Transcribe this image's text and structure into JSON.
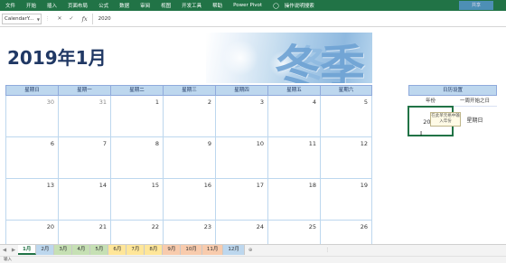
{
  "ribbon": {
    "tabs": [
      "文件",
      "开始",
      "插入",
      "页面布局",
      "公式",
      "数据",
      "审阅",
      "视图",
      "开发工具",
      "帮助",
      "Power Pivot"
    ],
    "tell_me": "操作说明搜索",
    "share_label": "共享"
  },
  "formula_bar": {
    "name_box": "CalendarY...",
    "formula_value": "2020"
  },
  "calendar": {
    "title": "2019年1月",
    "banner_text": "冬季",
    "weekdays": [
      "星期日",
      "星期一",
      "星期二",
      "星期三",
      "星期四",
      "星期五",
      "星期六"
    ],
    "weeks": [
      [
        "30",
        "31",
        "1",
        "2",
        "3",
        "4",
        "5"
      ],
      [
        "6",
        "7",
        "8",
        "9",
        "10",
        "11",
        "12"
      ],
      [
        "13",
        "14",
        "15",
        "16",
        "17",
        "18",
        "19"
      ],
      [
        "20",
        "21",
        "22",
        "23",
        "24",
        "25",
        "26"
      ]
    ]
  },
  "settings": {
    "title": "日历设置",
    "year_label": "年份",
    "week_start_label": "一周开始之日",
    "year_value": "2020",
    "week_start_value": "星期日",
    "tooltip": "在此单元格中输入年份"
  },
  "sheet_tabs": [
    "1月",
    "2月",
    "3月",
    "4月",
    "5月",
    "6月",
    "7月",
    "8月",
    "9月",
    "10月",
    "11月",
    "12月"
  ],
  "sheet_tab_colors": [
    "#ffffff",
    "#bdd7ee",
    "#c6e0b4",
    "#c6e0b4",
    "#c6e0b4",
    "#ffe699",
    "#ffe699",
    "#ffe699",
    "#f8cbad",
    "#f8cbad",
    "#f8cbad",
    "#bdd7ee"
  ],
  "active_sheet": "1月",
  "status": {
    "text": "输入"
  }
}
